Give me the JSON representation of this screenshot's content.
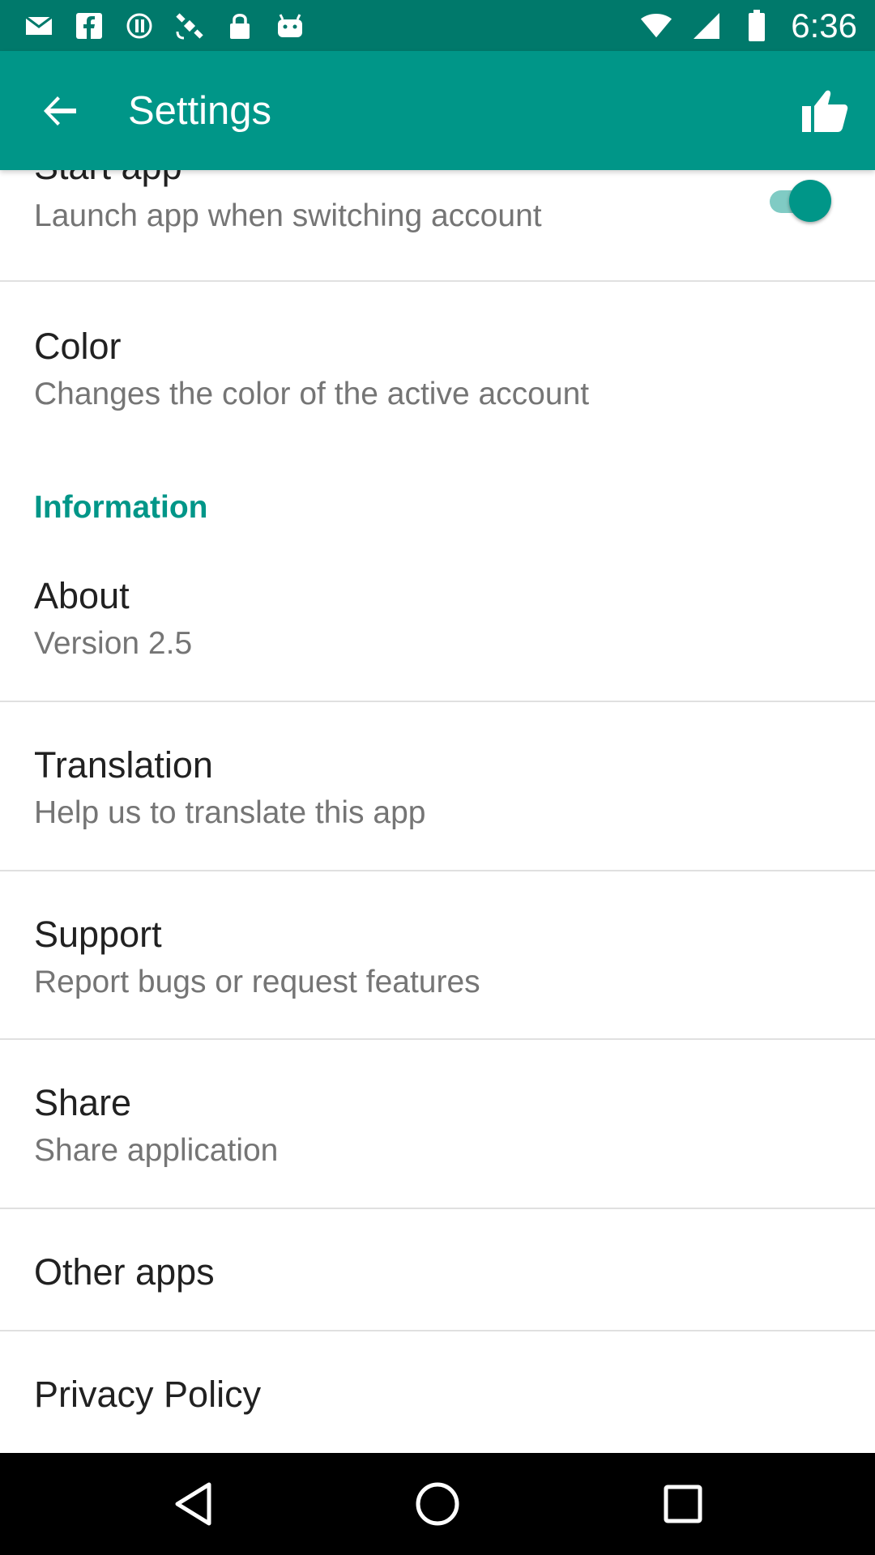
{
  "status_bar": {
    "time": "6:36",
    "left_icons": [
      "mail-icon",
      "facebook-icon",
      "sync-circle-icon",
      "satellite-icon",
      "lock-icon",
      "android-icon"
    ],
    "right_icons": [
      "wifi-icon",
      "signal-icon",
      "battery-icon"
    ]
  },
  "app_bar": {
    "title": "Settings",
    "back_icon": "arrow-back-icon",
    "action_icon": "thumbs-up-icon",
    "color": "#009688"
  },
  "items": [
    {
      "title": "Start app",
      "subtitle": "Launch app when switching account",
      "toggle": true
    },
    {
      "title": "Color",
      "subtitle": "Changes the color of the active account"
    }
  ],
  "section": {
    "header": "Information"
  },
  "info_items": [
    {
      "title": "About",
      "subtitle": "Version 2.5"
    },
    {
      "title": "Translation",
      "subtitle": "Help us to translate this app"
    },
    {
      "title": "Support",
      "subtitle": "Report bugs or request features"
    },
    {
      "title": "Share",
      "subtitle": "Share application"
    },
    {
      "title": "Other apps"
    },
    {
      "title": "Privacy Policy"
    }
  ],
  "nav_bar": {
    "icons": [
      "back-triangle-icon",
      "home-circle-icon",
      "recents-square-icon"
    ]
  },
  "colors": {
    "accent": "#009688",
    "status_bar": "#00796b",
    "switch_track": "#80cbc4"
  }
}
